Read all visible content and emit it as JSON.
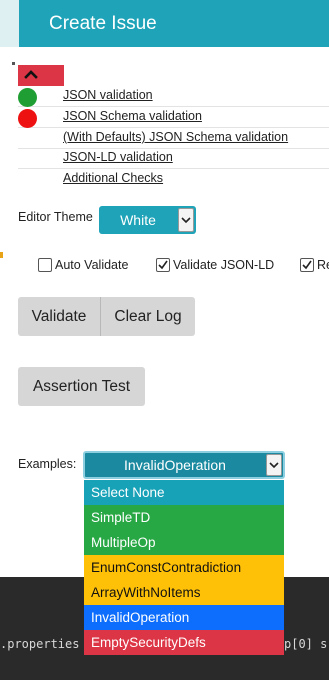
{
  "header": {
    "create_issue_label": "Create Issue"
  },
  "validations": [
    {
      "label": "JSON validation",
      "status": "success",
      "color": "#1f9e33"
    },
    {
      "label": "JSON Schema validation",
      "status": "error",
      "color": "#ee1111"
    },
    {
      "label": "(With Defaults) JSON Schema validation",
      "status": "none"
    },
    {
      "label": "JSON-LD validation",
      "status": "none"
    },
    {
      "label": "Additional Checks",
      "status": "none"
    }
  ],
  "collapse_button": {
    "icon": "chevron-up-icon",
    "color": "#dc3545"
  },
  "editor_theme": {
    "label": "Editor Theme",
    "value": "White"
  },
  "options": {
    "auto_validate": {
      "label": "Auto Validate",
      "checked": false
    },
    "validate_jsonld": {
      "label": "Validate JSON-LD",
      "checked": true
    },
    "third": {
      "label": "Re",
      "checked": true
    }
  },
  "buttons": {
    "validate": "Validate",
    "clear_log": "Clear Log",
    "assertion_test": "Assertion Test"
  },
  "examples": {
    "label": "Examples:",
    "selected": "InvalidOperation",
    "options": [
      {
        "label": "Select None",
        "color": "#17a2b8"
      },
      {
        "label": "SimpleTD",
        "color": "#28a745"
      },
      {
        "label": "MultipleOp",
        "color": "#28a745"
      },
      {
        "label": "EnumConstContradiction",
        "color": "#ffc107"
      },
      {
        "label": "ArrayWithNoItems",
        "color": "#ffc107"
      },
      {
        "label": "InvalidOperation",
        "color": "#0d6efd"
      },
      {
        "label": "EmptySecurityDefs",
        "color": "#dc3545"
      }
    ]
  },
  "console": {
    "line_left": ".properties",
    "line_right": "p[0] s"
  }
}
